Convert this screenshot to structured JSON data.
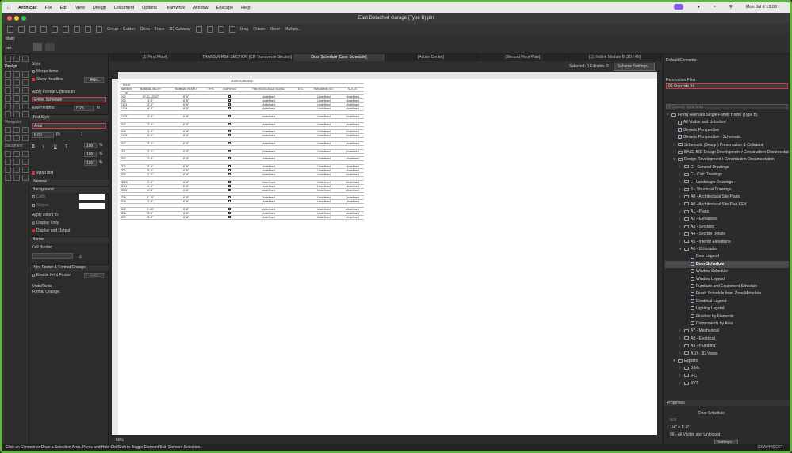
{
  "menubar": {
    "app": "Archicad",
    "items": [
      "File",
      "Edit",
      "View",
      "Design",
      "Document",
      "Options",
      "Teamwork",
      "Window",
      "Enscape",
      "Help"
    ],
    "clock": "Mon Jul 6 13:08"
  },
  "window": {
    "title": "East Detached Garage (Type B).pln"
  },
  "toolbar": {
    "group": "Group",
    "guides": "Guides",
    "grids": "Grids",
    "trace": "Trace",
    "cutaway": "3D Cutaway",
    "drag": "Drag",
    "rotate": "Rotate",
    "mirror": "Mirror",
    "multiply": "Multiply..."
  },
  "left": {
    "main": "Main:",
    "pet": "pet",
    "design": "Design",
    "viewpoint": "Viewpoint",
    "document": "Document"
  },
  "settings": {
    "style": "Style:",
    "merge_items": "Merge items",
    "show_headline": "Show Headline",
    "edit_btn": "Edit...",
    "apply_format": "Apply Format Options to:",
    "entire_schedule": "Entire Schedule",
    "row_heights": "Row Heights:",
    "row_height_value": "0.25",
    "row_height_unit": "in",
    "text_style": "Text Style",
    "font": "Arial",
    "font_size": "8.00",
    "font_unit": "Pt",
    "spin1": "1",
    "scale1": "100",
    "scale2": "100",
    "scale3": "100",
    "pct": "%",
    "wrap_text": "Wrap text",
    "preview": "Preview",
    "background": "Background",
    "cells": "Cells",
    "stripes": "Stripes",
    "apply_colors": "Apply colors to:",
    "display_only": "Display Only",
    "display_output": "Display and Output",
    "border": "Border",
    "cell_border": "Cell Border:",
    "pen_num": "2",
    "print_footer_sect": "Print Footer & Format Change",
    "enable_print_footer": "Enable Print Footer",
    "edit2": "Edit...",
    "undo_redo": "Undo/Redo",
    "format_change": "Format Change:"
  },
  "tabs": [
    {
      "label": "[1. First Floor]",
      "active": false
    },
    {
      "label": "TRANSVERSE SECTION [CD Transverse Section]",
      "active": false
    },
    {
      "label": "Door Schedule [Door Schedule]",
      "active": true
    },
    {
      "label": "[Action Center]",
      "active": false
    },
    {
      "label": "[Second Floor Plan]",
      "active": false
    },
    {
      "label": "[1] Hotlink Module B [3D / All]",
      "active": false
    }
  ],
  "viewtb": {
    "selected": "Selected: 0",
    "editable": "Editable: 0",
    "scheme_btn": "Scheme Settings..."
  },
  "schedule": {
    "title": "DOOR SCHEDULE",
    "col_door": "DOOR",
    "col_number": "NUMBER",
    "col_id": "ID",
    "col_width": "NOMINAL WIDTH",
    "col_height": "NOMINAL HEIGHT",
    "col_type": "TYPE",
    "col_tempered": "TEMPERED",
    "col_fire": "FIRE RESISTANCE RATING",
    "col_etc": "ETC.",
    "col_hardware": "HARDWARE SET",
    "col_notes": "NOTES",
    "rows": [
      {
        "id": "D04",
        "w": "10'-11 13/32\"",
        "h": "8'-0\"",
        "hw": "Undefined",
        "notes": "Undefined"
      },
      {
        "id": "D05",
        "w": "3'-0\"",
        "h": "6'-8\"",
        "hw": "Undefined",
        "notes": "Undefined"
      },
      {
        "id": "E101",
        "w": "3'-0\"",
        "h": "6'-8\"",
        "hw": "Undefined",
        "notes": "Undefined"
      },
      {
        "id": "E104",
        "w": "6'-0\"",
        "h": "8'-0\"",
        "hw": "Undefined",
        "notes": "Undefined"
      },
      {
        "id": "",
        "w": "",
        "h": "",
        "hw": "",
        "notes": ""
      },
      {
        "id": "E105",
        "w": "3'-0\"",
        "h": "6'-8\"",
        "hw": "Undefined",
        "notes": "Undefined"
      },
      {
        "id": "",
        "w": "",
        "h": "",
        "hw": "",
        "notes": ""
      },
      {
        "id": "1D0",
        "w": "3'-4\"",
        "h": "6'-8\"",
        "hw": "Undefined",
        "notes": "Undefined"
      },
      {
        "id": "",
        "w": "",
        "h": "",
        "hw": "",
        "notes": ""
      },
      {
        "id": "1D6",
        "w": "3'-0\"",
        "h": "6'-8\"",
        "hw": "Undefined",
        "notes": "Undefined"
      },
      {
        "id": "E109",
        "w": "6'-0\"",
        "h": "8'-0\"",
        "hw": "Undefined",
        "notes": "Undefined"
      },
      {
        "id": "",
        "w": "",
        "h": "",
        "hw": "",
        "notes": ""
      },
      {
        "id": "1D7",
        "w": "3'-0\"",
        "h": "6'-8\"",
        "hw": "Undefined",
        "notes": "Undefined"
      },
      {
        "id": "",
        "w": "",
        "h": "",
        "hw": "",
        "notes": ""
      },
      {
        "id": "2D1",
        "w": "3'-0\"",
        "h": "6'-8\"",
        "hw": "Undefined",
        "notes": "Undefined"
      },
      {
        "id": "",
        "w": "",
        "h": "",
        "hw": "",
        "notes": ""
      },
      {
        "id": "2D0",
        "w": "2'-6\"",
        "h": "6'-8\"",
        "hw": "Undefined",
        "notes": "Undefined"
      },
      {
        "id": "",
        "w": "",
        "h": "",
        "hw": "",
        "notes": ""
      },
      {
        "id": "2D2",
        "w": "2'-6\"",
        "h": "6'-8\"",
        "hw": "Undefined",
        "notes": "Undefined"
      },
      {
        "id": "2D3",
        "w": "3'-0\"",
        "h": "6'-8\"",
        "hw": "Undefined",
        "notes": "Undefined"
      },
      {
        "id": "2D5",
        "w": "2'-0\"",
        "h": "6'-8\"",
        "hw": "Undefined",
        "notes": "Undefined"
      },
      {
        "id": "",
        "w": "",
        "h": "",
        "hw": "",
        "notes": ""
      },
      {
        "id": "2D13",
        "w": "2'-6\"",
        "h": "6'-8\"",
        "hw": "Undefined",
        "notes": "Undefined"
      },
      {
        "id": "2D11",
        "w": "2'-6\"",
        "h": "6'-8\"",
        "hw": "Undefined",
        "notes": "Undefined"
      },
      {
        "id": "2D12",
        "w": "2'-6\"",
        "h": "6'-8\"",
        "hw": "Undefined",
        "notes": "Undefined"
      },
      {
        "id": "",
        "w": "",
        "h": "",
        "hw": "",
        "notes": ""
      },
      {
        "id": "2D8",
        "w": "2'-10\"",
        "h": "6'-8\"",
        "hw": "Undefined",
        "notes": "Undefined"
      },
      {
        "id": "2D9",
        "w": "2'-6\"",
        "h": "6'-8\"",
        "hw": "Undefined",
        "notes": "Undefined"
      },
      {
        "id": "",
        "w": "",
        "h": "",
        "hw": "",
        "notes": ""
      },
      {
        "id": "2D5",
        "w": "2'-10\"",
        "h": "6'-8\"",
        "hw": "Undefined",
        "notes": "Undefined"
      },
      {
        "id": "2D6",
        "w": "3'-0\"",
        "h": "6'-8\"",
        "hw": "Undefined",
        "notes": "Undefined"
      },
      {
        "id": "2D7",
        "w": "3'-0\"",
        "h": "6'-8\"",
        "hw": "Undefined",
        "notes": "Undefined"
      }
    ]
  },
  "viewstatus": {
    "zoom": "50%"
  },
  "right": {
    "default_elements": "Default Elements:",
    "renovation_filter": "Renovation Filter:",
    "renovation_value": "06 Override All",
    "search_placeholder": "Search View Map",
    "properties": "Properties",
    "prop_name": "Door Schedule",
    "prop_na": "N/A",
    "prop_scale": "1/4\" = 1'-0\"",
    "prop_layer": "06 - All Visible and Unlocked",
    "settings_btn": "Settings..."
  },
  "nav": [
    {
      "label": "Firefly Avenues Single Family Home (Type B)",
      "level": 0,
      "arrow": "v",
      "kind": "folder"
    },
    {
      "label": "All Visible and Unlocked",
      "level": 1,
      "arrow": "",
      "kind": "doc"
    },
    {
      "label": "Generic Perspective",
      "level": 1,
      "arrow": "",
      "kind": "doc"
    },
    {
      "label": "Generic Perspective - Schematic",
      "level": 1,
      "arrow": "",
      "kind": "doc"
    },
    {
      "label": "Schematic (Design) Presentation & Collateral",
      "level": 1,
      "arrow": ">",
      "kind": "folder"
    },
    {
      "label": "BASE BID Design Development / Construction Documentation",
      "level": 1,
      "arrow": ">",
      "kind": "folder"
    },
    {
      "label": "Design Development / Construction Documentation",
      "level": 1,
      "arrow": "v",
      "kind": "folder"
    },
    {
      "label": "G - General Drawings",
      "level": 2,
      "arrow": ">",
      "kind": "folder"
    },
    {
      "label": "C - Civil Drawings",
      "level": 2,
      "arrow": ">",
      "kind": "folder"
    },
    {
      "label": "L - Landscape Drawings",
      "level": 2,
      "arrow": ">",
      "kind": "folder"
    },
    {
      "label": "S - Structural Drawings",
      "level": 2,
      "arrow": ">",
      "kind": "folder"
    },
    {
      "label": "A0 - Architectural Site Plans",
      "level": 2,
      "arrow": ">",
      "kind": "folder"
    },
    {
      "label": "A0 - Architectural Site Plan KEY",
      "level": 2,
      "arrow": ">",
      "kind": "folder"
    },
    {
      "label": "A1 - Plans",
      "level": 2,
      "arrow": ">",
      "kind": "folder"
    },
    {
      "label": "A2 - Elevations",
      "level": 2,
      "arrow": ">",
      "kind": "folder"
    },
    {
      "label": "A3 - Sections",
      "level": 2,
      "arrow": ">",
      "kind": "folder"
    },
    {
      "label": "A4 - Section Details",
      "level": 2,
      "arrow": ">",
      "kind": "folder"
    },
    {
      "label": "A5 - Interior Elevations",
      "level": 2,
      "arrow": ">",
      "kind": "folder"
    },
    {
      "label": "A6 - Schedules",
      "level": 2,
      "arrow": "v",
      "kind": "folder"
    },
    {
      "label": "Door Legend",
      "level": 3,
      "arrow": "",
      "kind": "doc"
    },
    {
      "label": "Door Schedule",
      "level": 3,
      "arrow": "",
      "kind": "doc",
      "sel": true
    },
    {
      "label": "Window Schedule",
      "level": 3,
      "arrow": "",
      "kind": "doc"
    },
    {
      "label": "Window Legend",
      "level": 3,
      "arrow": "",
      "kind": "doc"
    },
    {
      "label": "Furniture and Equipment Schedule",
      "level": 3,
      "arrow": "",
      "kind": "doc"
    },
    {
      "label": "Finish Schedule from Zone Metadata",
      "level": 3,
      "arrow": "",
      "kind": "doc"
    },
    {
      "label": "Electrical Legend",
      "level": 3,
      "arrow": "",
      "kind": "doc"
    },
    {
      "label": "Lighting Legend",
      "level": 3,
      "arrow": "",
      "kind": "doc"
    },
    {
      "label": "Finishes by Elements",
      "level": 3,
      "arrow": "",
      "kind": "doc"
    },
    {
      "label": "Components by Area",
      "level": 3,
      "arrow": "",
      "kind": "doc"
    },
    {
      "label": "A7 - Mechanical",
      "level": 2,
      "arrow": ">",
      "kind": "folder"
    },
    {
      "label": "A8 - Electrical",
      "level": 2,
      "arrow": ">",
      "kind": "folder"
    },
    {
      "label": "A9 - Plumbing",
      "level": 2,
      "arrow": ">",
      "kind": "folder"
    },
    {
      "label": "A10 - 3D Views",
      "level": 2,
      "arrow": ">",
      "kind": "folder"
    },
    {
      "label": "Exports",
      "level": 1,
      "arrow": "v",
      "kind": "folder"
    },
    {
      "label": "BIMx",
      "level": 2,
      "arrow": ">",
      "kind": "folder"
    },
    {
      "label": "IFC",
      "level": 2,
      "arrow": ">",
      "kind": "folder"
    },
    {
      "label": "SVT",
      "level": 2,
      "arrow": ">",
      "kind": "folder"
    }
  ],
  "status": {
    "hint": "Click an Element or Draw a Selection Area. Press and Hold Ctrl/Shift to Toggle Element/Sub-Element Selection.",
    "brand": "GRAPHISOFT"
  },
  "colors": {
    "accent_red": "#d33b3b",
    "frame_green": "#64b245",
    "selection_blue": "#3b78d8"
  }
}
